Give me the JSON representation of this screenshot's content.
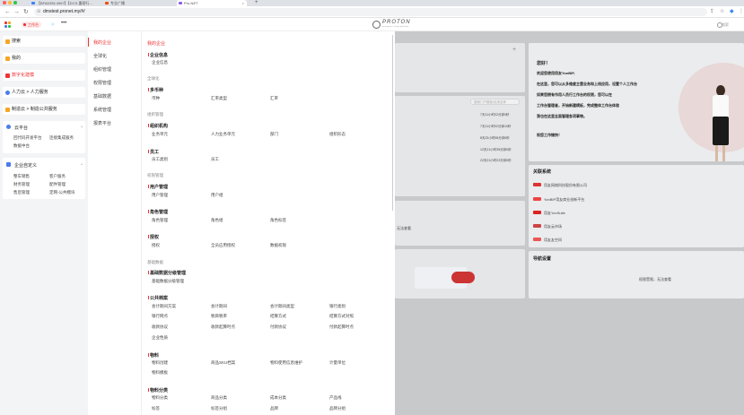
{
  "browser": {
    "tabs": [
      {
        "label": "【BFADEM-4967】【DCS-重磅行...",
        "color": "#3b82f6"
      },
      {
        "label": "专业广播",
        "color": "#e65100"
      },
      {
        "label": "Pro-NET",
        "color": "#8b5cf6"
      }
    ],
    "new_tab": "+",
    "url": "dmstest.pronet.my/#/",
    "nav": {
      "back": "←",
      "forward": "→",
      "reload": "↻"
    },
    "icons": {
      "share": "⇪",
      "star": "☆",
      "ext": "◆",
      "menu": "⋮"
    }
  },
  "header": {
    "workspace": "工作台",
    "round_label": "◎",
    "more": "•••",
    "logo_text": "PROTON",
    "logo_sub": "enterprise cloud platform",
    "search": "搜索"
  },
  "left_nav": {
    "top_items": [
      {
        "label": "搜索",
        "color": "#f5a623"
      },
      {
        "label": "我的",
        "color": "#f5a623"
      },
      {
        "label": "数字化建模",
        "color": "#e33",
        "active": true
      },
      {
        "label": "人力云 > 人力服务",
        "color": "#4b7bec"
      },
      {
        "label": "制造云 > 制造公共服务",
        "color": "#f5a623"
      }
    ],
    "cloud": {
      "title": "云平台",
      "items": [
        "回代码开发平台",
        "连接集成服务",
        "数据中台"
      ]
    },
    "custom": {
      "title": "企业自定义",
      "items": [
        "整车销售",
        "客户服务",
        "财务管理",
        "配件管理",
        "售后管理",
        "定网-公共模块"
      ]
    }
  },
  "menu_level1": {
    "items": [
      "我的企业",
      "全球化",
      "组织管理",
      "权限管理",
      "基础数据",
      "系统管理",
      "报表平台"
    ],
    "selected": "我的企业"
  },
  "menu_level2": {
    "title": "我的企业",
    "groups": [
      {
        "group": "",
        "sections": [
          {
            "name": "企业信息",
            "items": [
              "企业信息"
            ]
          }
        ]
      },
      {
        "group": "全球化",
        "sections": [
          {
            "name": "多币种",
            "items": [
              "币种",
              "汇率类型",
              "汇率"
            ]
          }
        ]
      },
      {
        "group": "组织管理",
        "sections": [
          {
            "name": "组织机构",
            "items": [
              "业务单元",
              "人力业务单元",
              "部门",
              "组织形态"
            ]
          },
          {
            "name": "员工",
            "items": [
              "员工类别",
              "员工"
            ]
          }
        ]
      },
      {
        "group": "权限管理",
        "sections": [
          {
            "name": "用户管理",
            "items": [
              "用户管理",
              "用户组"
            ]
          },
          {
            "name": "角色管理",
            "items": [
              "角色管理",
              "角色组",
              "角色标签"
            ]
          },
          {
            "name": "授权",
            "items": [
              "授权",
              "全员应用授权",
              "数据权限"
            ]
          }
        ]
      },
      {
        "group": "基础数据",
        "sections": [
          {
            "name": "基础数据分级管理",
            "items": [
              "基础数据分级管理"
            ]
          },
          {
            "name": "公共档案",
            "items": [
              "会计期间方案",
              "会计期间",
              "会计期间类型",
              "银行类别",
              "银行网点",
              "税目税率",
              "结算方式",
              "结算方式对照",
              "收款协议",
              "收款起算时点",
              "付款协议",
              "付款起算时点",
              "企业性质"
            ]
          },
          {
            "name": "物料",
            "items": [
              "物料创建",
              "商品SKU档案",
              "物料使用信息维护",
              "计量单位",
              "物料模板"
            ]
          },
          {
            "name": "物料分类",
            "items": [
              "物料分类",
              "商品分类",
              "成本分类",
              "产品线",
              "标签",
              "标签分组",
              "品牌",
              "品牌分组"
            ]
          }
        ]
      }
    ]
  },
  "dashboard": {
    "search_placeholder": "搜索门户模板/应用名称",
    "timestamps": [
      "7天11小时02分钟0秒",
      "7天11小时02分钟10秒",
      "8天23小时55分钟0秒",
      "12天21小时35分钟0秒",
      "22天21小时22分钟0秒"
    ],
    "plus": "+",
    "no_perm_1": "无法查看",
    "welcome": {
      "title": "您好！",
      "lines": [
        "欢迎您使用用友YonBIP,",
        "在这里，您可以从多维度主营业务和上线应用，设置个人工作台",
        "如果您拥有作用人员行工作台的权限，您可以在",
        "工作台管理者，开始新建模板，完成整体工作台体验",
        "我也在这里全面管理各项事物。",
        "祝您工作愉快！"
      ]
    },
    "related": {
      "title": "关联系统",
      "items": [
        {
          "label": "用友网络科技股份有限公司",
          "color": "#d33"
        },
        {
          "label": "YonBIP用友商业创新平台",
          "color": "#e44"
        },
        {
          "label": "用友YonSuite",
          "color": "#d22"
        },
        {
          "label": "用友云市场",
          "color": "#c44"
        },
        {
          "label": "用友友空间",
          "color": "#e55"
        }
      ]
    },
    "nav_settings": {
      "title": "导航设置",
      "msg": "权限受限，无法查看"
    }
  }
}
